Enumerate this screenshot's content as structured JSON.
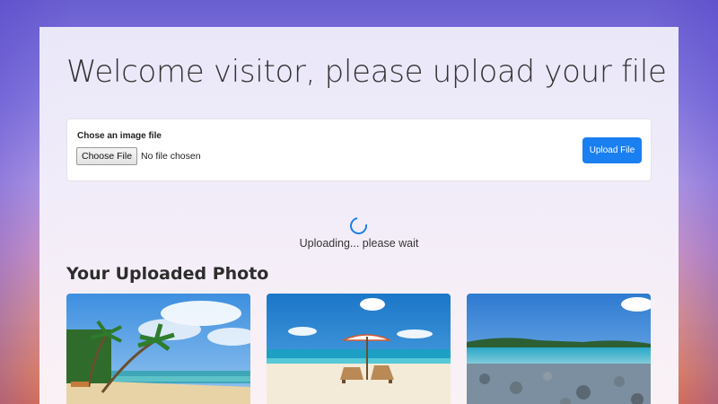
{
  "header": {
    "title": "Welcome visitor, please upload your file"
  },
  "upload_form": {
    "label": "Chose an image file",
    "choose_button": "Choose File",
    "file_status": "No file chosen",
    "submit_button": "Upload File"
  },
  "status": {
    "text": "Uploading... please wait"
  },
  "gallery": {
    "title": "Your Uploaded Photo",
    "photos": [
      {
        "subject": "tropical beach with palm trees"
      },
      {
        "subject": "beach with umbrella and lounge chairs"
      },
      {
        "subject": "rocky coastline with clear water"
      }
    ]
  },
  "colors": {
    "accent": "#1a7ff0"
  }
}
